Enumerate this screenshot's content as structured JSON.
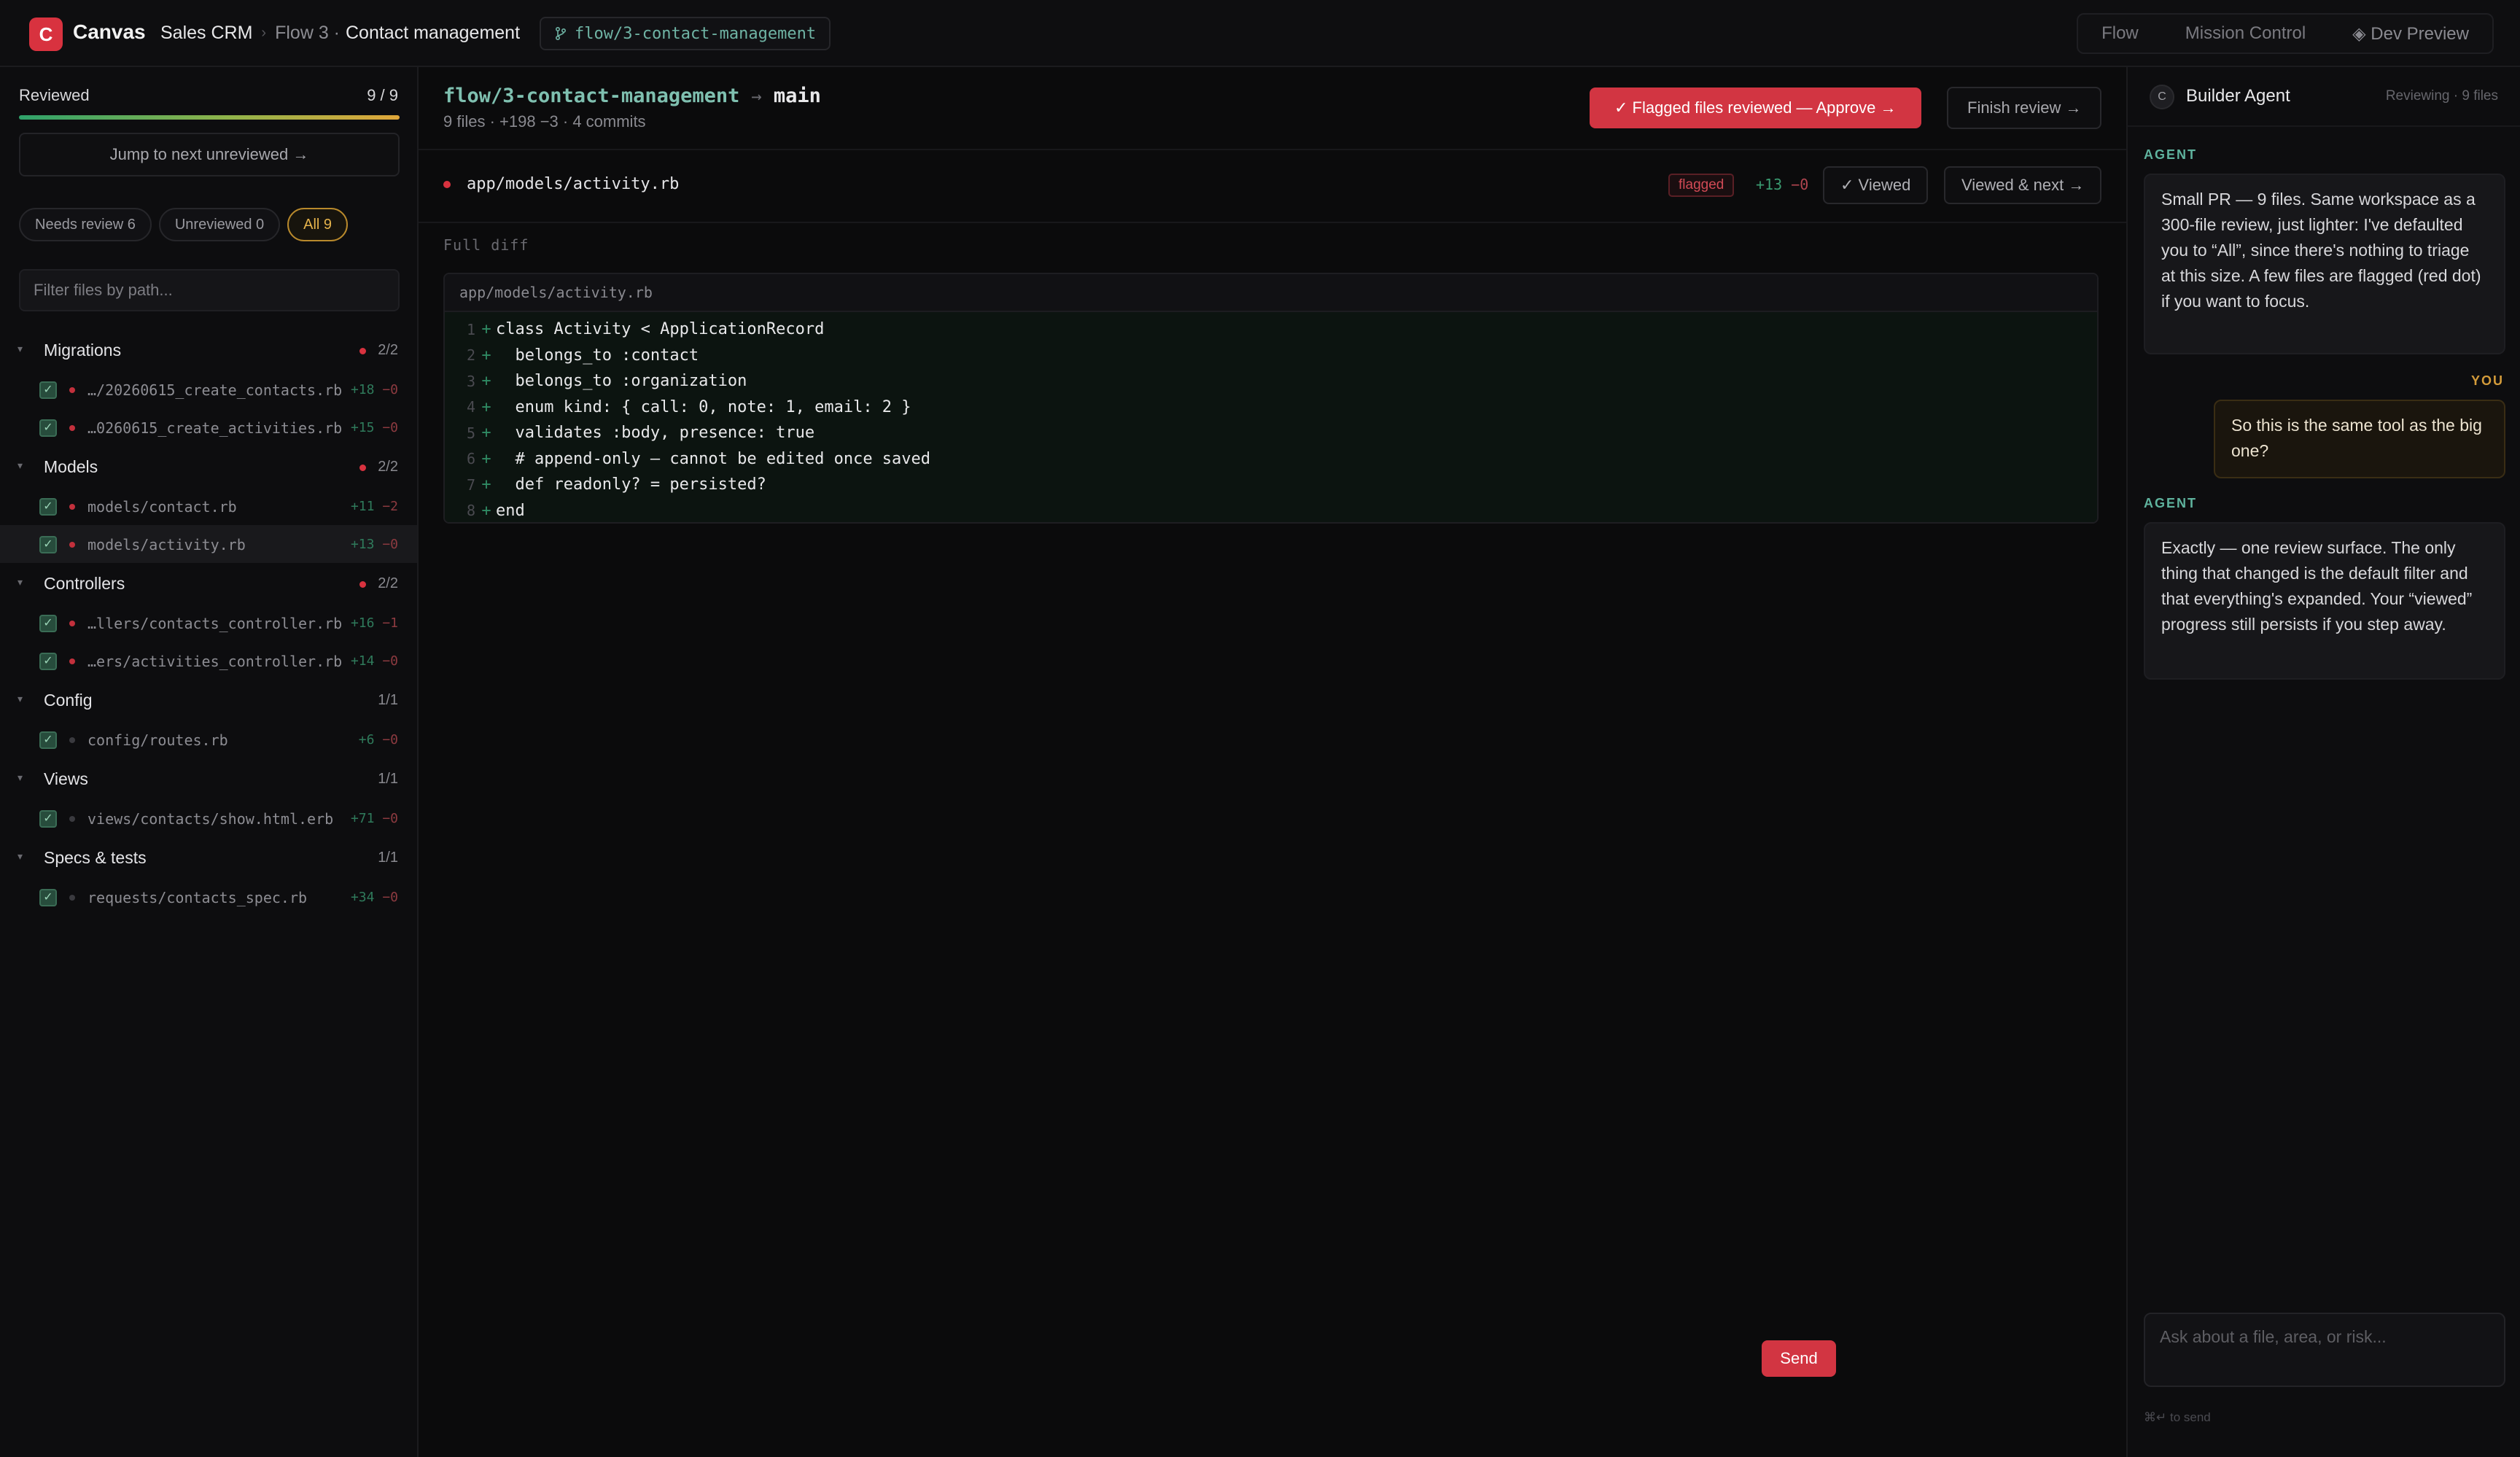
{
  "app": {
    "logo_letter": "C",
    "name": "Canvas",
    "breadcrumbs": [
      "Sales CRM",
      "Flow 3 ·",
      "Contact management"
    ],
    "branch_pill": "flow/3-contact-management",
    "nav": [
      "Flow",
      "Mission Control",
      "◈ Dev Preview"
    ]
  },
  "sidebar": {
    "reviewed_label": "Reviewed",
    "reviewed_count": "9 / 9",
    "reviewed_progress": 1.0,
    "jump_label": "Jump to next unreviewed →",
    "filters": [
      "Needs review 6",
      "Unreviewed 0",
      "All 9"
    ],
    "active_filter": "All 9",
    "filter_placeholder": "Filter files by path...",
    "groups": [
      {
        "name": "Migrations",
        "flagged": true,
        "count": "2/2",
        "files": [
          {
            "name": "…/20260615_create_contacts.rb",
            "add": "+18",
            "del": "−0",
            "flagged": true
          },
          {
            "name": "…0260615_create_activities.rb",
            "add": "+15",
            "del": "−0",
            "flagged": true
          }
        ]
      },
      {
        "name": "Models",
        "flagged": true,
        "count": "2/2",
        "files": [
          {
            "name": "models/contact.rb",
            "add": "+11",
            "del": "−2",
            "flagged": true
          },
          {
            "name": "models/activity.rb",
            "add": "+13",
            "del": "−0",
            "flagged": true,
            "selected": true
          }
        ]
      },
      {
        "name": "Controllers",
        "flagged": true,
        "count": "2/2",
        "files": [
          {
            "name": "…llers/contacts_controller.rb",
            "add": "+16",
            "del": "−1",
            "flagged": true
          },
          {
            "name": "…ers/activities_controller.rb",
            "add": "+14",
            "del": "−0",
            "flagged": true
          }
        ]
      },
      {
        "name": "Config",
        "flagged": false,
        "count": "1/1",
        "files": [
          {
            "name": "config/routes.rb",
            "add": "+6",
            "del": "−0",
            "flagged": false
          }
        ]
      },
      {
        "name": "Views",
        "flagged": false,
        "count": "1/1",
        "files": [
          {
            "name": "views/contacts/show.html.erb",
            "add": "+71",
            "del": "−0",
            "flagged": false
          }
        ]
      },
      {
        "name": "Specs & tests",
        "flagged": false,
        "count": "1/1",
        "files": [
          {
            "name": "requests/contacts_spec.rb",
            "add": "+34",
            "del": "−0",
            "flagged": false
          }
        ]
      }
    ]
  },
  "main": {
    "branch": "flow/3-contact-management",
    "arrow": "→",
    "target": "main",
    "meta": "9 files · +198 −3 · 4 commits",
    "approve_label": "✓ Flagged files reviewed — Approve →",
    "finish_label": "Finish review →",
    "file_path": "app/models/activity.rb",
    "flag_badge": "flagged",
    "file_add": "+13",
    "file_del": "−0",
    "viewed_label": "✓ Viewed",
    "viewed_next_label": "Viewed & next →",
    "full_diff_label": "Full diff",
    "diff_header": "app/models/activity.rb",
    "diff_lines": [
      {
        "n": "1",
        "code": "class Activity < ApplicationRecord"
      },
      {
        "n": "2",
        "code": "  belongs_to :contact"
      },
      {
        "n": "3",
        "code": "  belongs_to :organization"
      },
      {
        "n": "4",
        "code": "  enum kind: { call: 0, note: 1, email: 2 }"
      },
      {
        "n": "5",
        "code": "  validates :body, presence: true"
      },
      {
        "n": "6",
        "code": "  # append-only — cannot be edited once saved"
      },
      {
        "n": "7",
        "code": "  def readonly? = persisted?"
      },
      {
        "n": "8",
        "code": "end"
      }
    ]
  },
  "agent": {
    "avatar_letter": "C",
    "name": "Builder Agent",
    "status": "Reviewing · 9 files",
    "messages": [
      {
        "role": "AGENT",
        "text": "Small PR — 9 files. Same workspace as a 300-file review, just lighter: I've defaulted you to “All”, since there's nothing to triage at this size. A few files are flagged (red dot) if you want to focus."
      },
      {
        "role": "YOU",
        "text": "So this is the same tool as the big one?"
      },
      {
        "role": "AGENT",
        "text": "Exactly — one review surface. The only thing that changed is the default filter and that everything's expanded. Your “viewed” progress still persists if you step away."
      }
    ],
    "composer_placeholder": "Ask about a file, area, or risk...",
    "hint": "⌘↵ to send",
    "send_label": "Send"
  },
  "colors": {
    "accent_red": "#d23542",
    "branch_teal": "#7fc0b0",
    "you_gold": "#d39b3a"
  }
}
